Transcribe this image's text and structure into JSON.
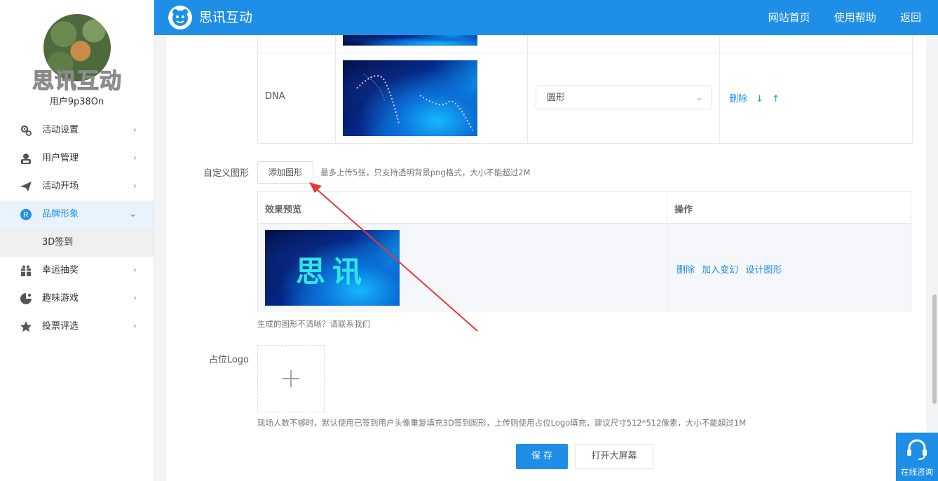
{
  "sidebar": {
    "brand_watermark": "思讯互动",
    "username": "用户9p38On",
    "menu": [
      {
        "label": "活动设置",
        "icon": "gear-icon"
      },
      {
        "label": "用户管理",
        "icon": "user-icon"
      },
      {
        "label": "活动开场",
        "icon": "paper-plane-icon"
      },
      {
        "label": "品牌形象",
        "icon": "registered-icon",
        "active": true
      },
      {
        "label": "幸运抽奖",
        "icon": "gift-icon"
      },
      {
        "label": "趣味游戏",
        "icon": "game-icon"
      },
      {
        "label": "投票评选",
        "icon": "star-icon"
      }
    ],
    "submenu": {
      "label": "3D签到"
    }
  },
  "topbar": {
    "brand": "思讯互动",
    "links": [
      "网站首页",
      "使用帮助",
      "返回"
    ]
  },
  "shapes_table": {
    "row": {
      "name": "DNA",
      "select_value": "圆形",
      "actions": {
        "delete": "删除",
        "down": "↓",
        "up": "↑"
      }
    }
  },
  "custom_shape": {
    "label": "自定义图形",
    "add_button": "添加图形",
    "hint": "最多上传5张，只支持透明背景png格式，大小不能超过2M",
    "table": {
      "headers": [
        "效果预览",
        "操作"
      ],
      "row": {
        "preview_text": "思讯",
        "actions": [
          "删除",
          "加入变幻",
          "设计图形"
        ]
      }
    },
    "footnote": "生成的图形不清晰？请联系我们"
  },
  "placeholder_logo": {
    "label": "占位Logo",
    "hint": "现场人数不够时，默认使用已签到用户头像重复填充3D签到图形，上传则使用占位Logo填充，建议尺寸512*512像素，大小不能超过1M"
  },
  "buttons": {
    "save": "保 存",
    "open_screen": "打开大屏幕"
  },
  "chat": {
    "label": "在线咨询"
  },
  "colors": {
    "accent": "#1e8ee6",
    "annotation_arrow": "#e53935"
  }
}
